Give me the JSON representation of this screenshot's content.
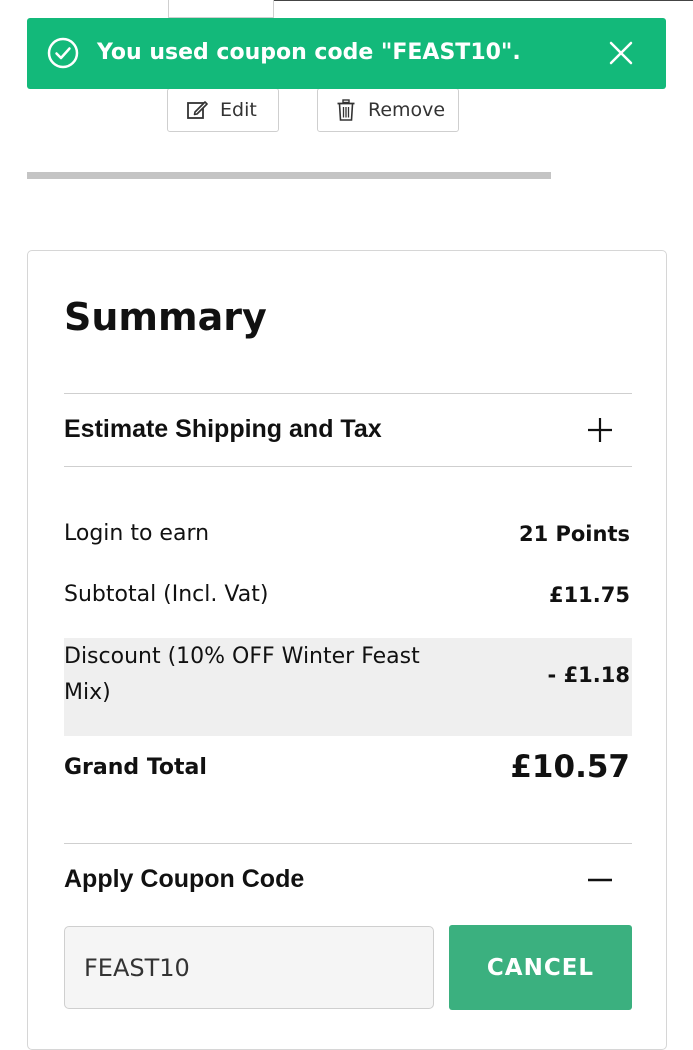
{
  "toast": {
    "message": "You used coupon code \"FEAST10\".",
    "icon": "check-circle-icon",
    "close_icon": "close-icon",
    "color": "#13b97a"
  },
  "item_actions": {
    "edit_label": "Edit",
    "remove_label": "Remove"
  },
  "summary": {
    "title": "Summary",
    "shipping_section_label": "Estimate Shipping and Tax",
    "rows": [
      {
        "label": "Login to earn",
        "value": "21 Points"
      },
      {
        "label": "Subtotal (Incl. Vat)",
        "value": "£11.75"
      }
    ],
    "discount": {
      "label": "Discount (10% OFF Winter Feast Mix)",
      "value": "- £1.18"
    },
    "grand_total": {
      "label": "Grand Total",
      "value": "£10.57"
    },
    "coupon": {
      "section_label": "Apply Coupon Code",
      "input_value": "FEAST10",
      "cancel_label": "CANCEL",
      "button_color": "#3bb07f"
    }
  }
}
